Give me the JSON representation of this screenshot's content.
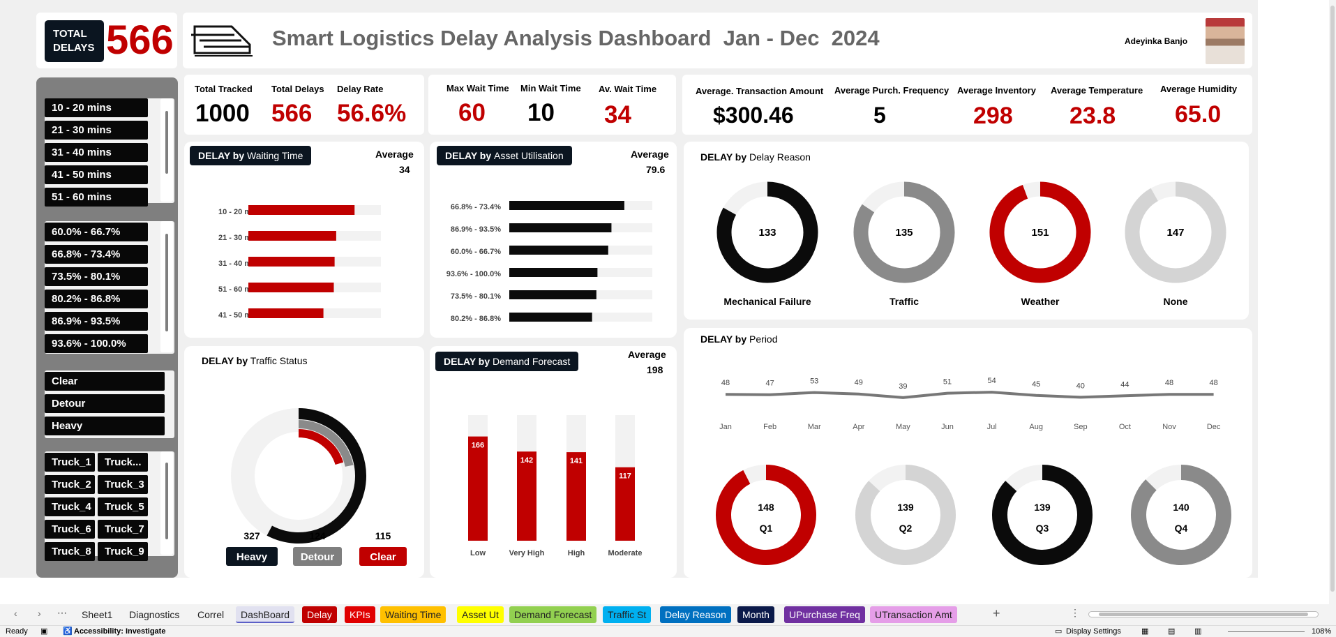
{
  "header": {
    "total_label_1": "TOTAL",
    "total_label_2": "DELAYS",
    "total_value": "566",
    "title": "Smart Logistics Delay Analysis Dashboard  Jan - Dec  2024",
    "author": "Adeyinka Banjo"
  },
  "slicers": {
    "waiting": [
      "10 - 20 mins",
      "21 - 30 mins",
      "31 - 40 mins",
      "41 - 50 mins",
      "51 - 60 mins"
    ],
    "asset": [
      "60.0% - 66.7%",
      "66.8% - 73.4%",
      "73.5% - 80.1%",
      "80.2% - 86.8%",
      "86.9% - 93.5%",
      "93.6% - 100.0%"
    ],
    "traffic": [
      "Clear",
      "Detour",
      "Heavy"
    ],
    "trucks": [
      "Truck_1",
      "Truck...",
      "Truck_2",
      "Truck_3",
      "Truck_4",
      "Truck_5",
      "Truck_6",
      "Truck_7",
      "Truck_8",
      "Truck_9"
    ]
  },
  "kpis": {
    "total_tracked": {
      "label": "Total  Tracked",
      "value": "1000"
    },
    "total_delays": {
      "label": "Total  Delays",
      "value": "566"
    },
    "delay_rate": {
      "label": "Delay Rate",
      "value": "56.6%"
    },
    "max_wait": {
      "label": "Max Wait Time",
      "value": "60"
    },
    "min_wait": {
      "label": "Min Wait Time",
      "value": "10"
    },
    "avg_wait": {
      "label": "Av. Wait Time",
      "value": "34"
    },
    "avg_txn": {
      "label": "Average. Transaction Amount",
      "value": "$300.46"
    },
    "avg_freq": {
      "label": "Average Purch. Frequency",
      "value": "5"
    },
    "avg_inv": {
      "label": "Average Inventory",
      "value": "298"
    },
    "avg_temp": {
      "label": "Average  Temperature",
      "value": "23.8"
    },
    "avg_hum": {
      "label": "Average Humidity",
      "value": "65.0"
    }
  },
  "colors": {
    "red": "#c00000",
    "black": "#0b0b0b",
    "gray": "#8a8a8a",
    "light": "#d4d4d4",
    "track": "#f2f2f2",
    "navy": "#0b1520"
  },
  "panels": {
    "waiting": {
      "title_bold": "DELAY by",
      "title_rest": "Waiting Time",
      "avg_label": "Average",
      "avg_value": "34"
    },
    "asset": {
      "title_bold": "DELAY by",
      "title_rest": "Asset Utilisation",
      "avg_label": "Average",
      "avg_value": "79.6"
    },
    "reason": {
      "title_bold": "DELAY by",
      "title_rest": "Delay Reason"
    },
    "traffic": {
      "title_bold": "DELAY by",
      "title_rest": "Traffic Status"
    },
    "demand": {
      "title_bold": "DELAY by",
      "title_rest": "Demand Forecast",
      "avg_label": "Average",
      "avg_value": "198"
    },
    "period": {
      "title_bold": "DELAY by",
      "title_rest": "Period"
    }
  },
  "tabs": [
    "Sheet1",
    "Diagnostics",
    "Correl",
    "DashBoard",
    "Delay",
    "KPIs",
    "Waiting Time",
    "Asset Ut",
    "Demand Forecast",
    "Traffic St",
    "Delay Reason",
    "Month",
    "UPurchase Freq",
    "UTransaction Amt"
  ],
  "status": {
    "ready": "Ready",
    "accessibility": "Accessibility: Investigate",
    "display": "Display Settings",
    "zoom": "108%"
  },
  "chart_data": [
    {
      "type": "bar",
      "orientation": "horizontal",
      "categories": [
        "10 - 20 mins",
        "21 - 30 mins",
        "31 - 40 mins",
        "51 - 60 mins",
        "41 - 50 mins"
      ],
      "values": [
        133,
        110,
        108,
        107,
        94
      ],
      "xlim": [
        0,
        166
      ]
    },
    {
      "type": "bar",
      "orientation": "horizontal",
      "categories": [
        "66.8% - 73.4%",
        "86.9% - 93.5%",
        "60.0% - 66.7%",
        "93.6% - 100.0%",
        "73.5% - 80.1%",
        "80.2% - 86.8%"
      ],
      "values": [
        107,
        95,
        92,
        82,
        81,
        77
      ],
      "xlim": [
        0,
        133
      ]
    },
    {
      "type": "pie",
      "variant": "donut",
      "categories": [
        "Mechanical Failure",
        "Traffic",
        "Weather",
        "None"
      ],
      "values": [
        133,
        135,
        151,
        147
      ],
      "max": 160
    },
    {
      "type": "pie",
      "variant": "radial",
      "categories": [
        "Heavy",
        "Detour",
        "Clear"
      ],
      "values": [
        327,
        124,
        115
      ]
    },
    {
      "type": "bar",
      "categories": [
        "Low",
        "Very High",
        "High",
        "Moderate"
      ],
      "values": [
        166,
        142,
        141,
        117
      ],
      "ylim": [
        0,
        200
      ]
    },
    {
      "type": "line",
      "categories": [
        "Jan",
        "Feb",
        "Mar",
        "Apr",
        "May",
        "Jun",
        "Jul",
        "Aug",
        "Sep",
        "Oct",
        "Nov",
        "Dec"
      ],
      "values": [
        48,
        47,
        53,
        49,
        39,
        51,
        54,
        45,
        40,
        44,
        48,
        48
      ]
    },
    {
      "type": "pie",
      "variant": "donut",
      "categories": [
        "Q1",
        "Q2",
        "Q3",
        "Q4"
      ],
      "values": [
        148,
        139,
        139,
        140
      ],
      "max": 160
    }
  ]
}
